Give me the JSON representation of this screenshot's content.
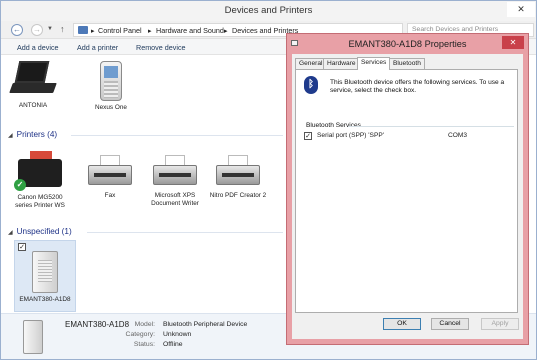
{
  "window": {
    "title": "Devices and Printers",
    "close_glyph": "✕"
  },
  "nav": {
    "back_glyph": "←",
    "forward_glyph": "→",
    "history_glyph": "▼",
    "up_glyph": "↑",
    "breadcrumb": [
      "Control Panel",
      "Hardware and Sound",
      "Devices and Printers"
    ],
    "separator": "▸",
    "search_placeholder": "Search Devices and Printers"
  },
  "commands": [
    "Add a device",
    "Add a printer",
    "Remove device"
  ],
  "devices": {
    "items": [
      {
        "label": "ANTONIA",
        "icon": "laptop-icon"
      },
      {
        "label": "Nexus One",
        "icon": "phone-icon"
      }
    ]
  },
  "printers": {
    "header": "Printers (4)",
    "items": [
      {
        "label": "Canon MG5200 series Printer WS",
        "icon": "printer-icon",
        "default": true
      },
      {
        "label": "Fax",
        "icon": "fax-icon"
      },
      {
        "label": "Microsoft XPS Document Writer",
        "icon": "printer-icon"
      },
      {
        "label": "Nitro PDF Creator 2",
        "icon": "printer-icon"
      }
    ]
  },
  "unspecified": {
    "header": "Unspecified (1)",
    "items": [
      {
        "label": "EMANT380-A1D8",
        "icon": "tower-icon",
        "checked": true
      }
    ]
  },
  "details": {
    "name": "EMANT380-A1D8",
    "fields": [
      {
        "label": "Model:",
        "value": "Bluetooth Peripheral Device"
      },
      {
        "label": "Category:",
        "value": "Unknown"
      },
      {
        "label": "Status:",
        "value": "Offline"
      }
    ]
  },
  "dialog": {
    "title": "EMANT380-A1D8 Properties",
    "close_glyph": "✕",
    "tabs": [
      "General",
      "Hardware",
      "Services",
      "Bluetooth"
    ],
    "active_tab": "Services",
    "description": "This Bluetooth device offers the following services. To use a service, select the check box.",
    "services_group_label": "Bluetooth Services",
    "services": [
      {
        "name": "Serial port (SPP) 'SPP'",
        "port": "COM3",
        "checked": true
      }
    ],
    "buttons": {
      "ok": "OK",
      "cancel": "Cancel",
      "apply": "Apply"
    }
  },
  "glyphs": {
    "check": "✓",
    "bluetooth": "ᛒ",
    "collapse": "◢"
  },
  "colors": {
    "dialog_frame": "#e8a0a6",
    "dialog_close": "#c9404a",
    "group_header": "#1e3287",
    "selection": "#dde8f5"
  }
}
